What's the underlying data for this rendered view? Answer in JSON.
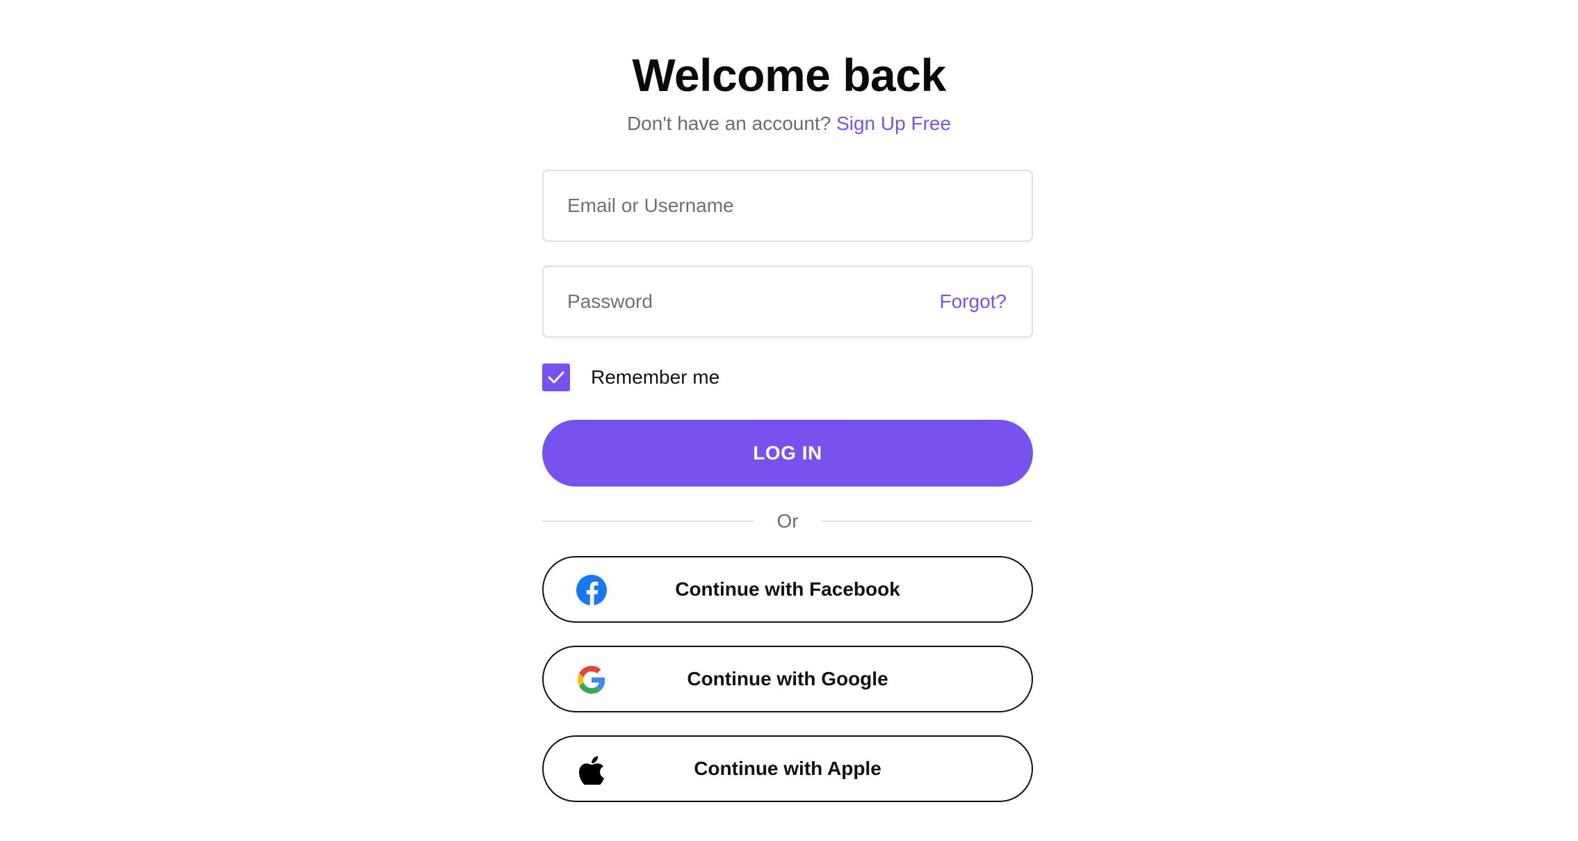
{
  "header": {
    "title": "Welcome back",
    "subtitle_text": "Don't have an account?",
    "signup_link": "Sign Up Free"
  },
  "form": {
    "email": {
      "placeholder": "Email or Username",
      "value": ""
    },
    "password": {
      "placeholder": "Password",
      "value": "",
      "forgot_label": "Forgot?"
    },
    "remember": {
      "label": "Remember me",
      "checked": true
    },
    "login_label": "LOG IN",
    "divider_label": "Or"
  },
  "social": [
    {
      "label": "Continue with Facebook",
      "icon": "facebook-icon"
    },
    {
      "label": "Continue with Google",
      "icon": "google-icon"
    },
    {
      "label": "Continue with Apple",
      "icon": "apple-icon"
    }
  ],
  "colors": {
    "accent": "#7752ee",
    "facebook": "#1877f2",
    "text": "#111111",
    "muted": "#6b6b6b",
    "border": "#dedede"
  }
}
